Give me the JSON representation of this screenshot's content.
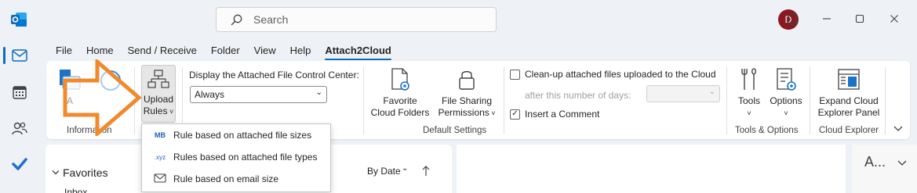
{
  "search": {
    "placeholder": "Search"
  },
  "user": {
    "avatar_initial": "D"
  },
  "menu": {
    "tabs": [
      "File",
      "Home",
      "Send / Receive",
      "Folder",
      "View",
      "Help",
      "Attach2Cloud"
    ],
    "active_tab": "Attach2Cloud"
  },
  "ribbon": {
    "information": {
      "about_label_partial": "A",
      "group_label": "Information"
    },
    "upload_rules": {
      "line1": "Upload",
      "line2": "Rules"
    },
    "default_settings": {
      "display_label": "Display the Attached File Control Center:",
      "display_value": "Always",
      "favorite_line1": "Favorite",
      "favorite_line2": "Cloud Folders",
      "sharing_line1": "File Sharing",
      "sharing_line2": "Permissions",
      "cleanup_label": "Clean-up attached files uploaded to the Cloud",
      "days_label": "after this number of days:",
      "insert_comment_label": "Insert a Comment",
      "group_label": "Default Settings"
    },
    "tools_options": {
      "tools_label": "Tools",
      "options_label": "Options",
      "group_label": "Tools & Options"
    },
    "cloud_explorer": {
      "expand_line1": "Expand Cloud",
      "expand_line2": "Explorer Panel",
      "group_label": "Cloud Explorer"
    }
  },
  "dropdown_menu": {
    "items": [
      {
        "icon_text": "MB",
        "label": "Rule based on attached file sizes"
      },
      {
        "icon_text": ".xyz",
        "label": "Rules based on attached file types"
      },
      {
        "icon_text": "",
        "label": "Rule based on email size"
      }
    ]
  },
  "nav": {
    "favorites": "Favorites",
    "inbox_partial": "Inbox"
  },
  "list": {
    "sort_label": "By Date"
  },
  "right_pane": {
    "label_partial": "A..."
  },
  "colors": {
    "accent": "#0f6cbd",
    "arrow": "#f08a2c",
    "avatar": "#8b1820"
  }
}
